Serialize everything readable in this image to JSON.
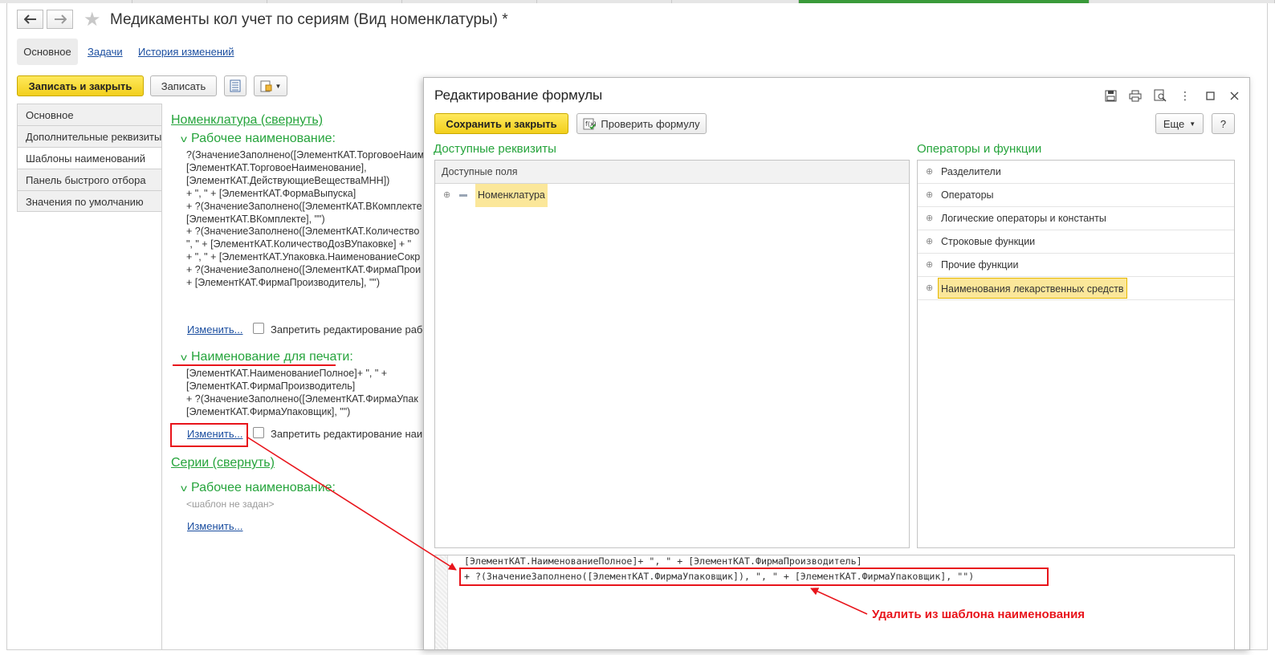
{
  "window": {
    "title": "Медикаменты кол учет по сериям (Вид номенклатуры) *",
    "nav_back_icon": "arrow-left-icon",
    "nav_forward_icon": "arrow-right-icon",
    "favorite_icon": "star-icon"
  },
  "tabs": [
    {
      "label": "Основное",
      "active": true
    },
    {
      "label": "Задачи"
    },
    {
      "label": "История изменений"
    }
  ],
  "toolbar": {
    "save_close_label": "Записать и закрыть",
    "save_label": "Записать"
  },
  "sidebar": {
    "items": [
      {
        "label": "Основное"
      },
      {
        "label": "Дополнительные реквизиты"
      },
      {
        "label": "Шаблоны наименований",
        "active": true
      },
      {
        "label": "Панель быстрого отбора"
      },
      {
        "label": "Значения по умолчанию"
      }
    ]
  },
  "nomenclature": {
    "group_title": "Номенклатура (свернуть)",
    "work_name": {
      "title": "Рабочее наименование:",
      "formula": "?(ЗначениеЗаполнено([ЭлементКАТ.ТорговоеНаим\n[ЭлементКАТ.ТорговоеНаименование],\n[ЭлементКАТ.ДействующиеВеществаМНН])\n+ \", \" + [ЭлементКАТ.ФормаВыпуска]\n+ ?(ЗначениеЗаполнено([ЭлементКАТ.ВКомплекте\n[ЭлементКАТ.ВКомплекте], \"\")\n+ ?(ЗначениеЗаполнено([ЭлементКАТ.Количество\n\", \" + [ЭлементКАТ.КоличествоДозВУпаковке] + \"\n+ \", \" + [ЭлементКАТ.Упаковка.НаименованиеСокр\n+ ?(ЗначениеЗаполнено([ЭлементКАТ.ФирмаПрои\n+ [ЭлементКАТ.ФирмаПроизводитель], \"\")",
      "change_link": "Изменить...",
      "checkbox_label": "Запретить редактирование рабоч"
    },
    "print_name": {
      "title": "Наименование для печати:",
      "formula": "[ЭлементКАТ.НаименованиеПолное]+ \", \" +\n[ЭлементКАТ.ФирмаПроизводитель]\n+ ?(ЗначениеЗаполнено([ЭлементКАТ.ФирмаУпак\n[ЭлементКАТ.ФирмаУпаковщик], \"\")",
      "change_link": "Изменить...",
      "checkbox_label": "Запретить редактирование наим"
    }
  },
  "series": {
    "group_title": "Серии (свернуть)",
    "work_name": {
      "title": "Рабочее наименование:",
      "placeholder": "<шаблон не задан>",
      "change_link": "Изменить..."
    }
  },
  "dialog": {
    "title": "Редактирование формулы",
    "header_icons": [
      "save-icon",
      "print-icon",
      "preview-icon",
      "more-icon",
      "maximize-icon",
      "close-icon"
    ],
    "save_close_label": "Сохранить и закрыть",
    "check_formula_label": "Проверить формулу",
    "more_label": "Еще",
    "help_label": "?",
    "available_title": "Доступные реквизиты",
    "available_header": "Доступные поля",
    "available_root": "Номенклатура",
    "operators_title": "Операторы и функции",
    "operators": [
      {
        "label": "Разделители"
      },
      {
        "label": "Операторы"
      },
      {
        "label": "Логические операторы и константы"
      },
      {
        "label": "Строковые функции"
      },
      {
        "label": "Прочие функции"
      },
      {
        "label": "Наименования лекарственных средств",
        "highlighted": true
      }
    ],
    "editor_lines": [
      "[ЭлементКАТ.НаименованиеПолное]+ \", \" + [ЭлементКАТ.ФирмаПроизводитель]",
      "+ ?(ЗначениеЗаполнено([ЭлементКАТ.ФирмаУпаковщик]), \", \" + [ЭлементКАТ.ФирмаУпаковщик], \"\")"
    ]
  },
  "annotation": {
    "text": "Удалить из шаблона наименования",
    "color": "#e8141b"
  }
}
